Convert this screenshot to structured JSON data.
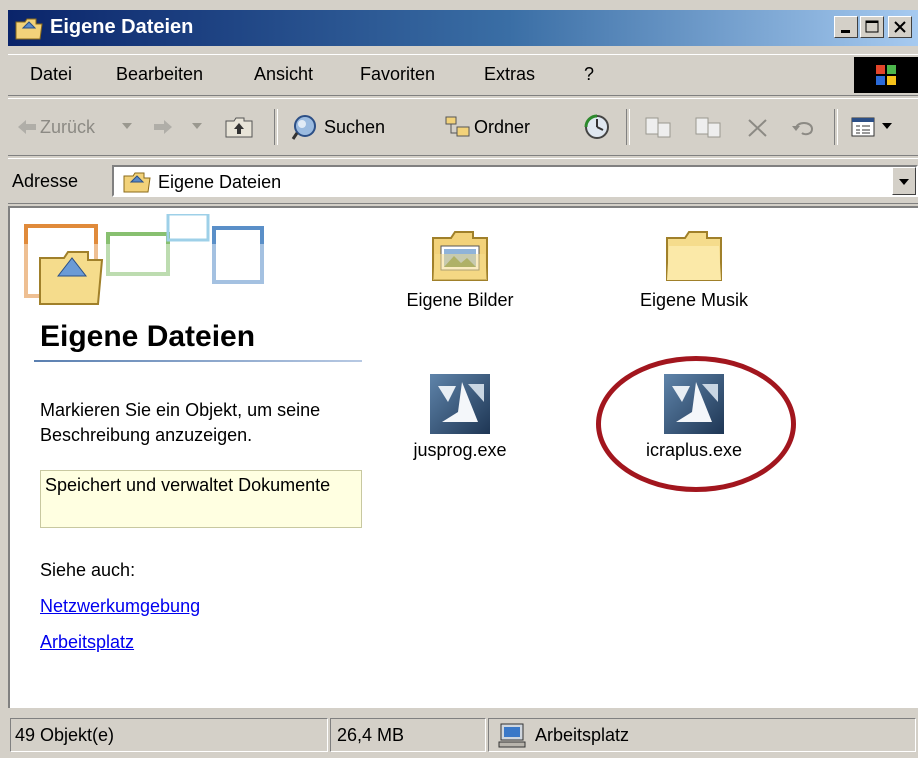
{
  "window": {
    "title": "Eigene Dateien"
  },
  "menu": {
    "items": [
      "Datei",
      "Bearbeiten",
      "Ansicht",
      "Favoriten",
      "Extras",
      "?"
    ]
  },
  "toolbar": {
    "back_label": "Zurück",
    "search_label": "Suchen",
    "folders_label": "Ordner"
  },
  "address": {
    "label": "Adresse",
    "value": "Eigene Dateien"
  },
  "panel": {
    "title": "Eigene Dateien",
    "description": "Markieren Sie ein Objekt, um seine Beschreibung anzuzeigen.",
    "info": "Speichert und verwaltet Dokumente",
    "see_also": "Siehe auch:",
    "links": [
      "Netzwerkumgebung",
      "Arbeitsplatz"
    ]
  },
  "items": [
    {
      "name": "Eigene Bilder",
      "icon": "pictures-folder-icon"
    },
    {
      "name": "Eigene Musik",
      "icon": "folder-icon"
    },
    {
      "name": "jusprog.exe",
      "icon": "application-icon"
    },
    {
      "name": "icraplus.exe",
      "icon": "application-icon",
      "highlight_color": "#a2161e"
    }
  ],
  "status": {
    "objects": "49 Objekt(e)",
    "size": "26,4 MB",
    "location": "Arbeitsplatz"
  },
  "colors": {
    "title_bar_start": "#0a246a",
    "title_bar_end": "#a6caf0",
    "chrome": "#d4d0c8",
    "link": "#0000ee",
    "highlight_ring": "#a2161e"
  }
}
